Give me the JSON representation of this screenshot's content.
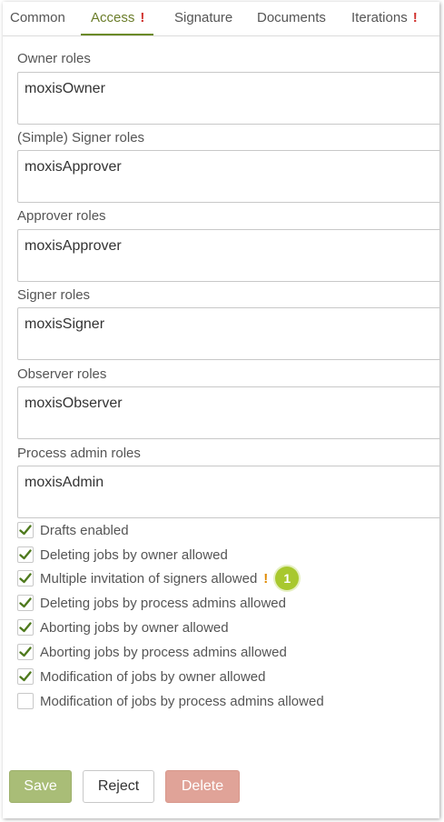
{
  "tabs": [
    {
      "label": "Common",
      "warning": ""
    },
    {
      "label": "Access",
      "warning": "!"
    },
    {
      "label": "Signature",
      "warning": ""
    },
    {
      "label": "Documents",
      "warning": ""
    },
    {
      "label": "Iterations",
      "warning": "!"
    }
  ],
  "fields": [
    {
      "label": "Owner roles",
      "value": "moxisOwner"
    },
    {
      "label": "(Simple) Signer roles",
      "value": "moxisApprover"
    },
    {
      "label": "Approver roles",
      "value": "moxisApprover"
    },
    {
      "label": "Signer roles",
      "value": "moxisSigner"
    },
    {
      "label": "Observer roles",
      "value": "moxisObserver"
    },
    {
      "label": "Process admin roles",
      "value": "moxisAdmin"
    }
  ],
  "checkboxes": [
    {
      "label": "Drafts enabled",
      "checked": true
    },
    {
      "label": "Deleting jobs by owner allowed",
      "checked": true
    },
    {
      "label": "Multiple invitation of signers allowed",
      "checked": true,
      "warning": "!",
      "badge": "1"
    },
    {
      "label": "Deleting jobs by process admins allowed",
      "checked": true
    },
    {
      "label": "Aborting jobs by owner allowed",
      "checked": true
    },
    {
      "label": "Aborting jobs by process admins allowed",
      "checked": true
    },
    {
      "label": "Modification of jobs by owner allowed",
      "checked": true
    },
    {
      "label": "Modification of jobs by process admins allowed",
      "checked": false
    }
  ],
  "buttons": {
    "save": "Save",
    "reject": "Reject",
    "delete": "Delete"
  },
  "colors": {
    "accent": "#6b8a22",
    "check": "#4f7a1e",
    "warning_red": "#d0312d",
    "warning_orange": "#e08a00",
    "badge": "#a8c82e",
    "save_bg": "#a9bd77",
    "delete_bg": "#e0a398"
  }
}
